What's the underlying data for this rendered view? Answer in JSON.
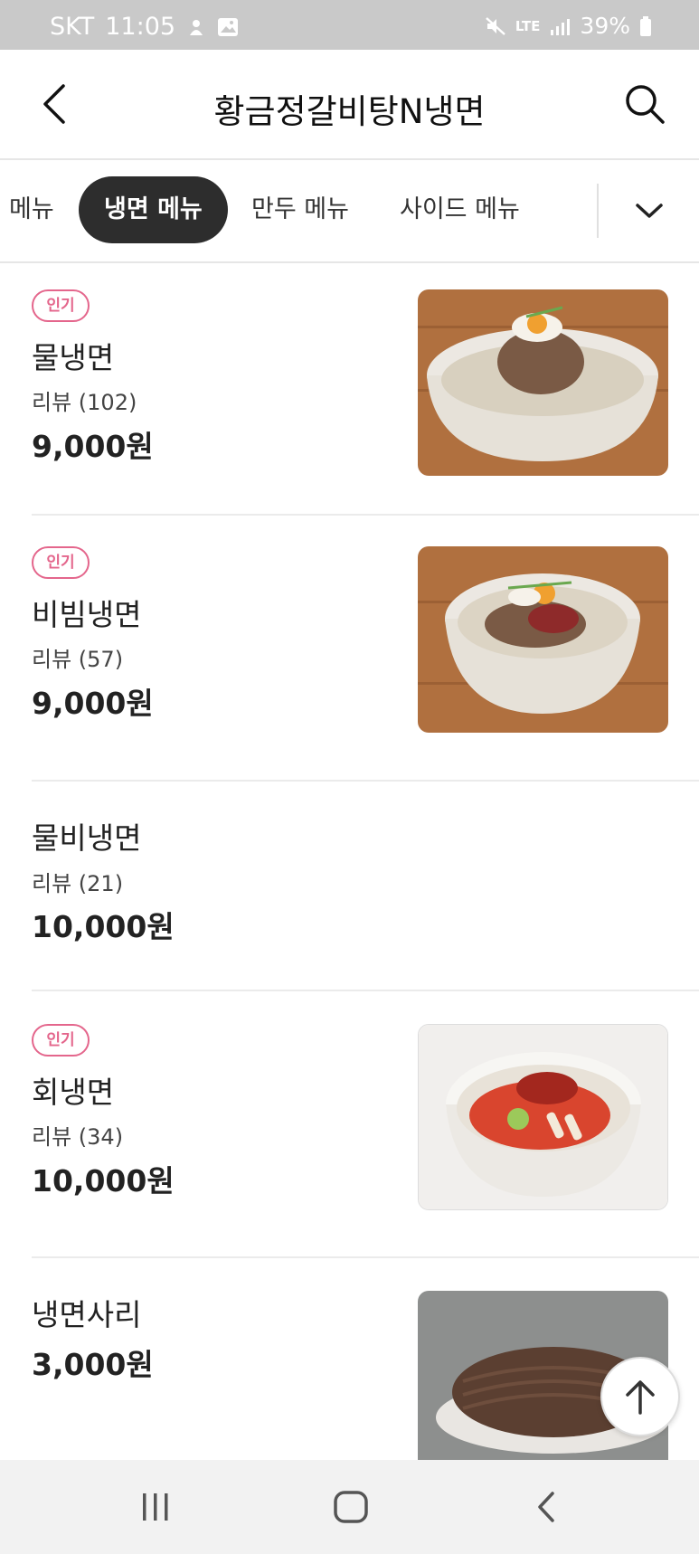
{
  "status_bar": {
    "carrier": "SKT",
    "time": "11:05",
    "network": "LTE",
    "battery": "39%"
  },
  "header": {
    "title": "황금정갈비탕N냉면"
  },
  "tabs": [
    {
      "label": "메뉴",
      "active": false
    },
    {
      "label": "냉면 메뉴",
      "active": true
    },
    {
      "label": "만두 메뉴",
      "active": false
    },
    {
      "label": "사이드 메뉴",
      "active": false
    }
  ],
  "menu_items": [
    {
      "badge": "인기",
      "name": "물냉면",
      "review": "리뷰 (102)",
      "price": "9,000원",
      "image": "mul-naengmyeon"
    },
    {
      "badge": "인기",
      "name": "비빔냉면",
      "review": "리뷰 (57)",
      "price": "9,000원",
      "image": "bibim-naengmyeon"
    },
    {
      "badge": "",
      "name": "물비냉면",
      "review": "리뷰 (21)",
      "price": "10,000원",
      "image": ""
    },
    {
      "badge": "인기",
      "name": "회냉면",
      "review": "리뷰 (34)",
      "price": "10,000원",
      "image": "hoe-naengmyeon"
    },
    {
      "badge": "",
      "name": "냉면사리",
      "review": "",
      "price": "3,000원",
      "image": "naengmyeon-sari"
    }
  ],
  "colors": {
    "badge": "#e4668c",
    "active_tab": "#2d2d2d",
    "status_bar": "#c9c9c9"
  },
  "icons": {
    "back": "chevron-left-icon",
    "search": "search-icon",
    "tabs_more": "chevron-down-icon",
    "scroll_top": "arrow-up-icon",
    "nav_recent": "recent-apps-icon",
    "nav_home": "home-icon",
    "nav_back": "back-icon"
  }
}
